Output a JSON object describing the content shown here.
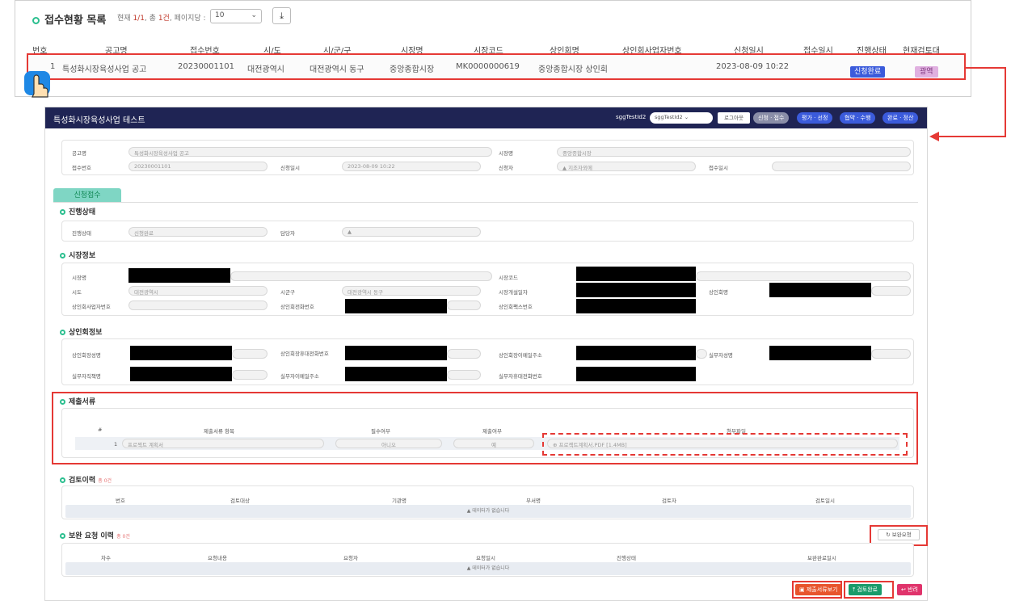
{
  "list": {
    "title": "접수현황 목록",
    "page_prefix": "현재",
    "page_current": "1/1",
    "page_mid": ", 총",
    "count": "1건",
    "page_suffix": ", 페이지당 :",
    "per_page": "10",
    "download_icon": "download-icon"
  },
  "columns": [
    "번호",
    "공고명",
    "접수번호",
    "시/도",
    "시/군/구",
    "시장명",
    "시장코드",
    "상인회명",
    "상인회사업자번호",
    "신청일시",
    "접수일시",
    "진행상태",
    "현재검토대"
  ],
  "row": {
    "no": "1",
    "notice": "특성화시장육성사업 공고",
    "receipt": "20230001101",
    "sido": "대전광역시",
    "sigungu": "대전광역시 동구",
    "market": "중앙종합시장",
    "code": "MK0000000619",
    "assoc": "중앙종합시장 상인회",
    "bizno": "",
    "applied": "2023-08-09 10:22",
    "received": "",
    "status": "신청완료",
    "reviewer": "광역"
  },
  "panel": {
    "title": "특성화시장육성사업 테스트",
    "user": "sggTestId2",
    "user_select": "sggTestId2",
    "logout": "로그아웃",
    "steps": [
      "신청 · 접수",
      "평가 · 선정",
      "협약 · 수행",
      "완료 · 정산"
    ],
    "fields": {
      "notice_l": "공고명",
      "notice_v": "특성화시장육성사업 공고",
      "market_l": "시장명",
      "market_v": "중앙종합시장",
      "receipt_l": "접수번호",
      "receipt_v": "20230001101",
      "applied_l": "신청일시",
      "applied_v": "2023-08-09 10:22",
      "applicant_l": "신청자",
      "applicant_v": "지조자외에",
      "receivedate_l": "접수일시"
    },
    "tab": "신청접수",
    "s1": "진행상태",
    "s1_status_l": "진행상태",
    "s1_status_v": "신청완료",
    "s1_mgr_l": "담당자",
    "s2": "시장정보",
    "s2_labels": [
      "시장명",
      "시장코드",
      "시도",
      "시군구",
      "시장개설일자",
      "상인회명",
      "상인회사업자번호",
      "상인회전화번호",
      "상인회팩스번호"
    ],
    "s2_sido_v": "대전광역시",
    "s2_sigungu_v": "대전광역시 동구",
    "s3": "상인회정보",
    "s3_labels": [
      "상인회장성명",
      "상인회장휴대전화번호",
      "상인회장이메일주소",
      "실무자성명",
      "실무자직책명",
      "실무자이메일주소",
      "실무자휴대전화번호"
    ],
    "s4": "제출서류",
    "s4_cols": [
      "#",
      "제출서류 항목",
      "필수여부",
      "제출여부",
      "첨부파일"
    ],
    "s4_row": {
      "no": "1",
      "item": "프로젝트 계획서",
      "req": "아니오",
      "sub": "예",
      "file": "프로젝트계획서.PDF [1.4MB]"
    },
    "s5": "검토이력",
    "s5_count": "총 0건",
    "s5_cols": [
      "번호",
      "검토대상",
      "기관명",
      "부서명",
      "검토자",
      "검토일시"
    ],
    "empty": "데이터가 없습니다",
    "s6": "보완 요청 이력",
    "s6_count": "총 0건",
    "s6_cols": [
      "차수",
      "요청내용",
      "요청자",
      "요청일시",
      "진행상태",
      "보완완료일시"
    ],
    "supp_btn": "보완요청",
    "btn_docs": "제출서류보기",
    "btn_review": "검토완료",
    "btn_back": "반려"
  }
}
